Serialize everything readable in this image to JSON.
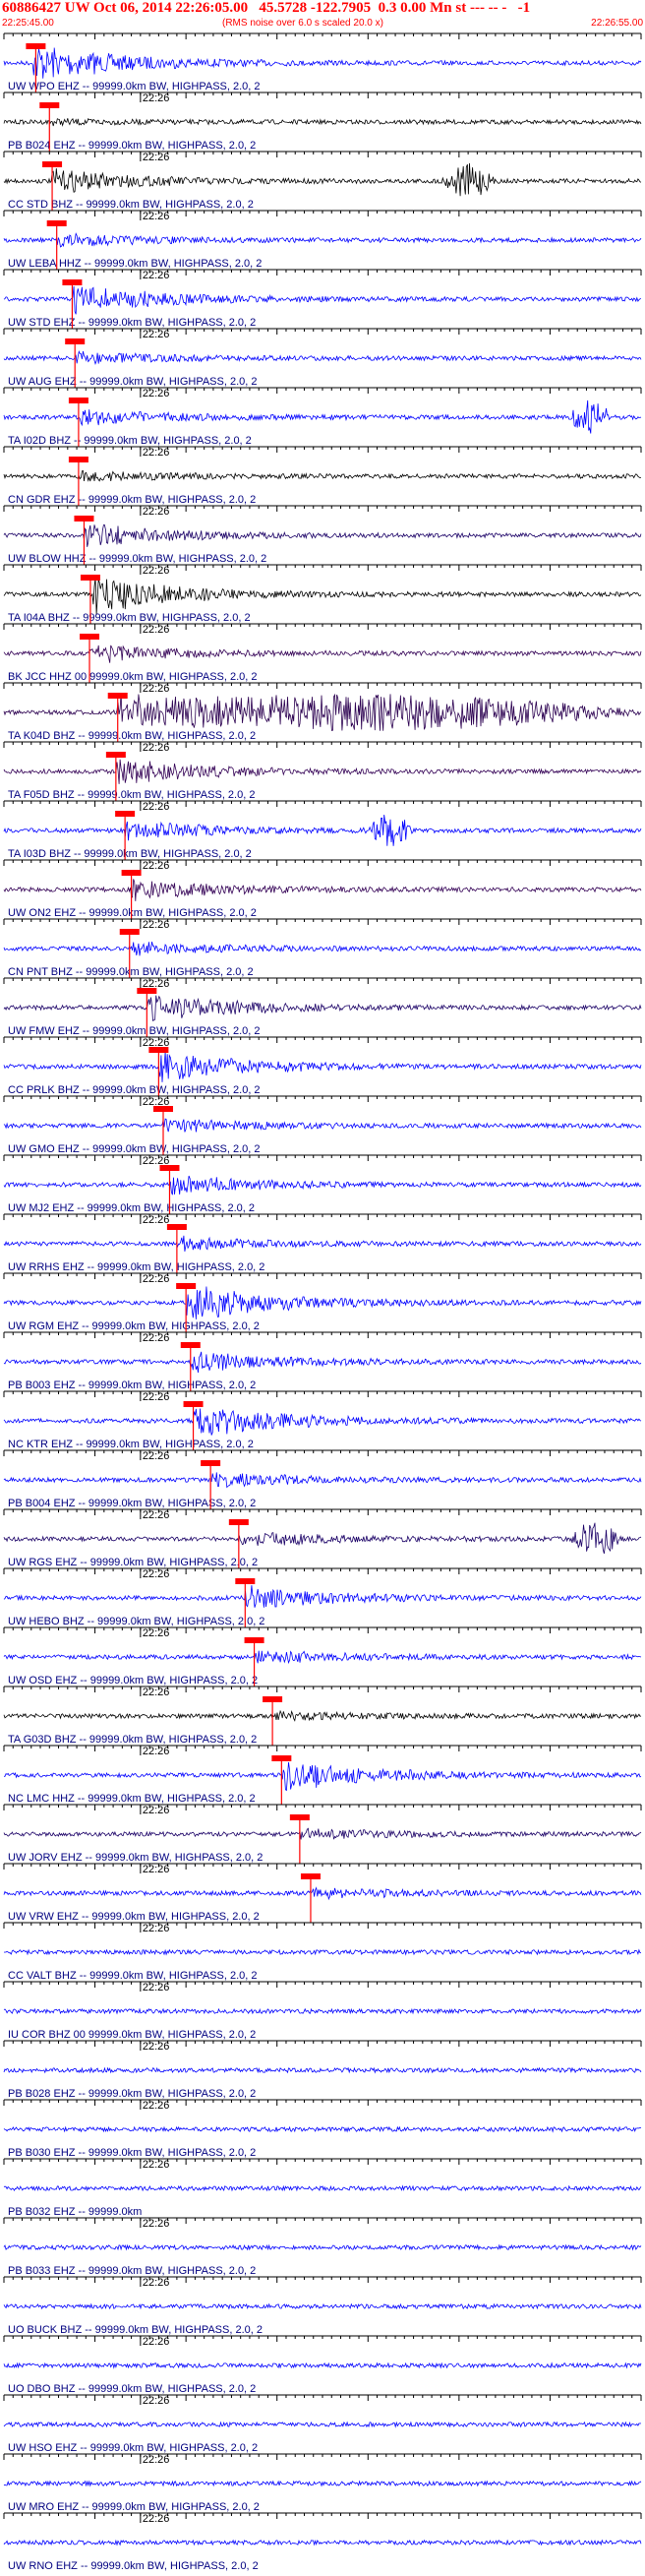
{
  "header": {
    "title": "60886427 UW Oct 06, 2014 22:26:05.00   45.5728 -122.7905  0.3 0.00 Mn st --- -- -   -1",
    "start_time": "22:25:45.00",
    "note": "(RMS noise over 6.0 s scaled 20.0 x)",
    "end_time": "22:26:55.00"
  },
  "colors": {
    "pick": "#ff0000",
    "label": "#000080",
    "axis": "#000000",
    "blue": "#0000ff",
    "black": "#000000",
    "navy": "#1a0066",
    "purple": "#330055",
    "darkpurple": "#2b0050"
  },
  "tick_label": "22:26",
  "chart_data": {
    "type": "seismogram",
    "time_start": "22:25:45.00",
    "time_end": "22:26:55.00",
    "traces": [
      {
        "label": "UW WPO  EHZ -- 99999.0km BW, HIGHPASS, 2.0, 2",
        "color": "blue",
        "pick": 3.5,
        "energy": 0.9,
        "eq_start": 3.2,
        "burst": [],
        "show_tick": false
      },
      {
        "label": "PB B024 EHZ -- 99999.0km BW, HIGHPASS, 2.0, 2",
        "color": "black",
        "pick": 5.0,
        "energy": 0.1,
        "eq_start": 5.0,
        "burst": [],
        "show_tick": true
      },
      {
        "label": "CC STD  BHZ -- 99999.0km BW, HIGHPASS, 2.0, 2",
        "color": "black",
        "pick": 5.3,
        "energy": 0.55,
        "eq_start": 5.3,
        "burst": [
          48,
          54
        ],
        "show_tick": true
      },
      {
        "label": "UW LEBA HHZ -- 99999.0km BW, HIGHPASS, 2.0, 2",
        "color": "blue",
        "pick": 5.8,
        "energy": 0.3,
        "eq_start": 5.8,
        "burst": [],
        "show_tick": true
      },
      {
        "label": "UW STD  EHZ -- 99999.0km BW, HIGHPASS, 2.0, 2",
        "color": "blue",
        "pick": 7.5,
        "energy": 0.7,
        "eq_start": 7.5,
        "burst": [],
        "show_tick": true
      },
      {
        "label": "UW AUG  EHZ -- 99999.0km BW, HIGHPASS, 2.0, 2",
        "color": "blue",
        "pick": 7.8,
        "energy": 0.25,
        "eq_start": 7.8,
        "burst": [],
        "show_tick": true
      },
      {
        "label": "TA I02D BHZ -- 99999.0km BW, HIGHPASS, 2.0, 2",
        "color": "blue",
        "pick": 8.2,
        "energy": 0.35,
        "eq_start": 8.2,
        "burst": [
          62,
          67
        ],
        "show_tick": true
      },
      {
        "label": "CN GDR  EHZ -- 99999.0km BW, HIGHPASS, 2.0, 2",
        "color": "black",
        "pick": 8.2,
        "energy": 0.2,
        "eq_start": 8.2,
        "burst": [],
        "show_tick": true
      },
      {
        "label": "UW BLOW HHZ -- 99999.0km BW, HIGHPASS, 2.0, 2",
        "color": "navy",
        "pick": 8.8,
        "energy": 0.55,
        "eq_start": 8.8,
        "burst": [],
        "show_tick": true
      },
      {
        "label": "TA I04A BHZ -- 99999.0km BW, HIGHPASS, 2.0, 2",
        "color": "black",
        "pick": 9.5,
        "energy": 0.9,
        "eq_start": 9.5,
        "burst": [],
        "show_tick": true
      },
      {
        "label": "BK JCC  HHZ 00 99999.0km BW, HIGHPASS, 2.0, 2",
        "color": "purple",
        "pick": 9.4,
        "energy": 0.45,
        "eq_start": 9.4,
        "burst": [],
        "show_tick": true
      },
      {
        "label": "TA K04D BHZ -- 99999.0km BW, HIGHPASS, 2.0, 2",
        "color": "darkpurple",
        "pick": 12.5,
        "energy": 1.0,
        "eq_start": 12.5,
        "burst": [
          14,
          70
        ],
        "show_tick": true
      },
      {
        "label": "TA F05D BHZ -- 99999.0km BW, HIGHPASS, 2.0, 2",
        "color": "purple",
        "pick": 12.3,
        "energy": 0.6,
        "eq_start": 12.3,
        "burst": [],
        "show_tick": true
      },
      {
        "label": "TA I03D BHZ -- 99999.0km BW, HIGHPASS, 2.0, 2",
        "color": "blue",
        "pick": 13.3,
        "energy": 0.45,
        "eq_start": 13.3,
        "burst": [
          40,
          45
        ],
        "show_tick": true
      },
      {
        "label": "UW ON2  EHZ -- 99999.0km BW, HIGHPASS, 2.0, 2",
        "color": "purple",
        "pick": 14.0,
        "energy": 0.5,
        "eq_start": 14.0,
        "burst": [],
        "show_tick": true
      },
      {
        "label": "CN PNT  BHZ -- 99999.0km BW, HIGHPASS, 2.0, 2",
        "color": "blue",
        "pick": 13.8,
        "energy": 0.3,
        "eq_start": 13.8,
        "burst": [],
        "show_tick": true
      },
      {
        "label": "UW FMW  EHZ -- 99999.0km BW, HIGHPASS, 2.0, 2",
        "color": "navy",
        "pick": 15.7,
        "energy": 0.7,
        "eq_start": 15.7,
        "burst": [],
        "show_tick": true
      },
      {
        "label": "CC PRLK BHZ -- 99999.0km BW, HIGHPASS, 2.0, 2",
        "color": "blue",
        "pick": 17.0,
        "energy": 0.75,
        "eq_start": 17.0,
        "burst": [],
        "show_tick": true
      },
      {
        "label": "UW GMO  EHZ -- 99999.0km BW, HIGHPASS, 2.0, 2",
        "color": "blue",
        "pick": 17.5,
        "energy": 0.3,
        "eq_start": 17.5,
        "burst": [],
        "show_tick": true
      },
      {
        "label": "UW MJ2  EHZ -- 99999.0km BW, HIGHPASS, 2.0, 2",
        "color": "blue",
        "pick": 18.2,
        "energy": 0.45,
        "eq_start": 18.2,
        "burst": [],
        "show_tick": true
      },
      {
        "label": "UW RRHS EHZ -- 99999.0km BW, HIGHPASS, 2.0, 2",
        "color": "blue",
        "pick": 19.0,
        "energy": 0.3,
        "eq_start": 19.0,
        "burst": [],
        "show_tick": true
      },
      {
        "label": "UW RGM  EHZ -- 99999.0km BW, HIGHPASS, 2.0, 2",
        "color": "blue",
        "pick": 20.0,
        "energy": 0.9,
        "eq_start": 20.0,
        "burst": [],
        "show_tick": true
      },
      {
        "label": "PB B003 EHZ -- 99999.0km BW, HIGHPASS, 2.0, 2",
        "color": "blue",
        "pick": 20.5,
        "energy": 0.5,
        "eq_start": 20.5,
        "burst": [],
        "show_tick": true
      },
      {
        "label": "NC KTR  EHZ -- 99999.0km BW, HIGHPASS, 2.0, 2",
        "color": "blue",
        "pick": 20.8,
        "energy": 0.85,
        "eq_start": 20.8,
        "burst": [],
        "show_tick": true
      },
      {
        "label": "PB B004 EHZ -- 99999.0km BW, HIGHPASS, 2.0, 2",
        "color": "blue",
        "pick": 22.7,
        "energy": 0.35,
        "eq_start": 22.7,
        "burst": [],
        "show_tick": true
      },
      {
        "label": "UW RGS  EHZ -- 99999.0km BW, HIGHPASS, 2.0, 2",
        "color": "navy",
        "pick": 25.8,
        "energy": 0.35,
        "eq_start": 25.8,
        "burst": [
          62,
          68
        ],
        "show_tick": true
      },
      {
        "label": "UW HEBO BHZ -- 99999.0km BW, HIGHPASS, 2.0, 2",
        "color": "blue",
        "pick": 26.5,
        "energy": 0.55,
        "eq_start": 26.5,
        "burst": [],
        "show_tick": true
      },
      {
        "label": "UW OSD  EHZ -- 99999.0km BW, HIGHPASS, 2.0, 2",
        "color": "blue",
        "pick": 27.5,
        "energy": 0.3,
        "eq_start": 27.5,
        "burst": [],
        "show_tick": true
      },
      {
        "label": "TA G03D BHZ -- 99999.0km BW, HIGHPASS, 2.0, 2",
        "color": "black",
        "pick": 29.5,
        "energy": 0.2,
        "eq_start": 29.5,
        "burst": [],
        "show_tick": true
      },
      {
        "label": "NC LMC  HHZ -- 99999.0km BW, HIGHPASS, 2.0, 2",
        "color": "blue",
        "pick": 30.5,
        "energy": 0.75,
        "eq_start": 30.5,
        "burst": [],
        "show_tick": true
      },
      {
        "label": "UW JORV EHZ -- 99999.0km BW, HIGHPASS, 2.0, 2",
        "color": "navy",
        "pick": 32.5,
        "energy": 0.25,
        "eq_start": 32.5,
        "burst": [],
        "show_tick": true
      },
      {
        "label": "UW VRW  EHZ -- 99999.0km BW, HIGHPASS, 2.0, 2",
        "color": "blue",
        "pick": 33.7,
        "energy": 0.25,
        "eq_start": 33.7,
        "burst": [],
        "show_tick": true
      },
      {
        "label": "CC VALT BHZ -- 99999.0km BW, HIGHPASS, 2.0, 2",
        "color": "blue",
        "pick": null,
        "energy": 0.0,
        "eq_start": null,
        "burst": [],
        "show_tick": true
      },
      {
        "label": "IU COR  BHZ 00 99999.0km BW, HIGHPASS, 2.0, 2",
        "color": "blue",
        "pick": null,
        "energy": 0.0,
        "eq_start": null,
        "burst": [],
        "show_tick": true
      },
      {
        "label": "PB B028 EHZ -- 99999.0km BW, HIGHPASS, 2.0, 2",
        "color": "blue",
        "pick": null,
        "energy": 0.0,
        "eq_start": null,
        "burst": [],
        "show_tick": true
      },
      {
        "label": "PB B030 EHZ -- 99999.0km BW, HIGHPASS, 2.0, 2",
        "color": "blue",
        "pick": null,
        "energy": 0.0,
        "eq_start": null,
        "burst": [],
        "show_tick": true
      },
      {
        "label": "PB B032 EHZ -- 99999.0km",
        "color": "blue",
        "pick": null,
        "energy": 0.0,
        "eq_start": null,
        "burst": [],
        "show_tick": true
      },
      {
        "label": "PB B033 EHZ -- 99999.0km BW, HIGHPASS, 2.0, 2",
        "color": "blue",
        "pick": null,
        "energy": 0.0,
        "eq_start": null,
        "burst": [],
        "show_tick": true
      },
      {
        "label": "UO BUCK BHZ -- 99999.0km BW, HIGHPASS, 2.0, 2",
        "color": "blue",
        "pick": null,
        "energy": 0.0,
        "eq_start": null,
        "burst": [],
        "show_tick": true
      },
      {
        "label": "UO DBO  BHZ -- 99999.0km BW, HIGHPASS, 2.0, 2",
        "color": "blue",
        "pick": null,
        "energy": 0.0,
        "eq_start": null,
        "burst": [],
        "show_tick": true
      },
      {
        "label": "UW HSO  EHZ -- 99999.0km BW, HIGHPASS, 2.0, 2",
        "color": "blue",
        "pick": null,
        "energy": 0.0,
        "eq_start": null,
        "burst": [],
        "show_tick": true
      },
      {
        "label": "UW MRO  EHZ -- 99999.0km BW, HIGHPASS, 2.0, 2",
        "color": "blue",
        "pick": null,
        "energy": 0.0,
        "eq_start": null,
        "burst": [],
        "show_tick": true
      },
      {
        "label": "UW RNO  EHZ -- 99999.0km BW, HIGHPASS, 2.0, 2",
        "color": "blue",
        "pick": null,
        "energy": 0.0,
        "eq_start": null,
        "burst": [],
        "show_tick": true
      }
    ]
  }
}
